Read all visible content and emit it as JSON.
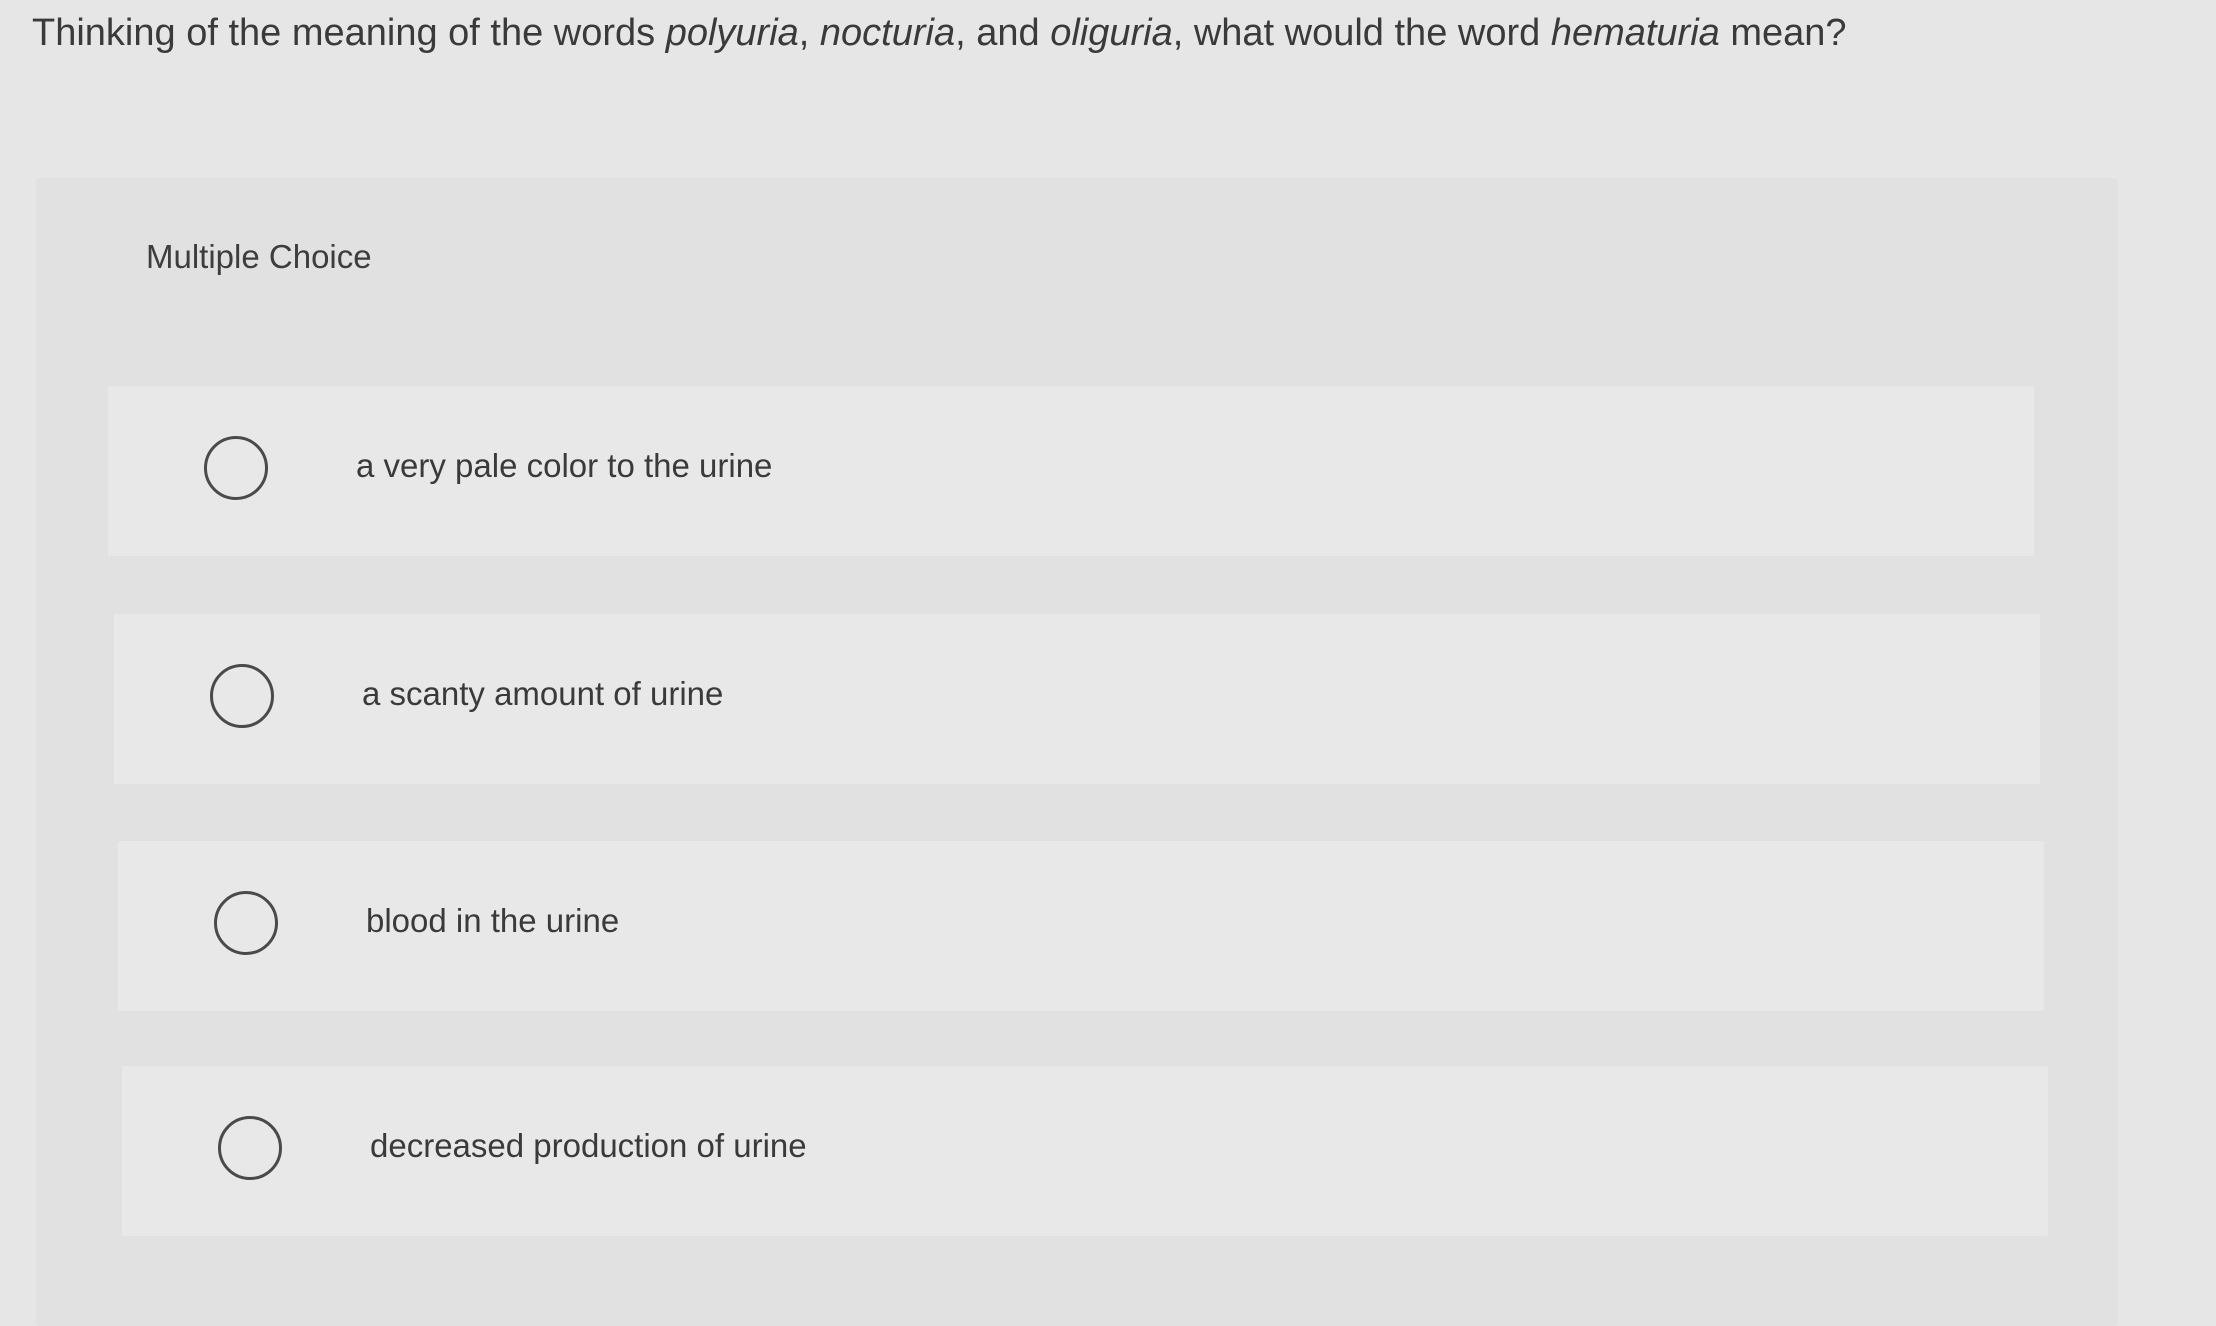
{
  "question": {
    "part1": "Thinking of the meaning of the words ",
    "word1": "polyuria",
    "sep1": ", ",
    "word2": "nocturia",
    "sep2": ", and ",
    "word3": "oliguria",
    "part2": ", what would the word ",
    "word4": "hematuria",
    "part3": " mean?"
  },
  "panel": {
    "heading": "Multiple Choice",
    "options": [
      {
        "label": "a very pale color to the urine",
        "selected": false
      },
      {
        "label": "a scanty amount of urine",
        "selected": false
      },
      {
        "label": "blood in the urine",
        "selected": false
      },
      {
        "label": "decreased production of urine",
        "selected": false
      }
    ]
  }
}
